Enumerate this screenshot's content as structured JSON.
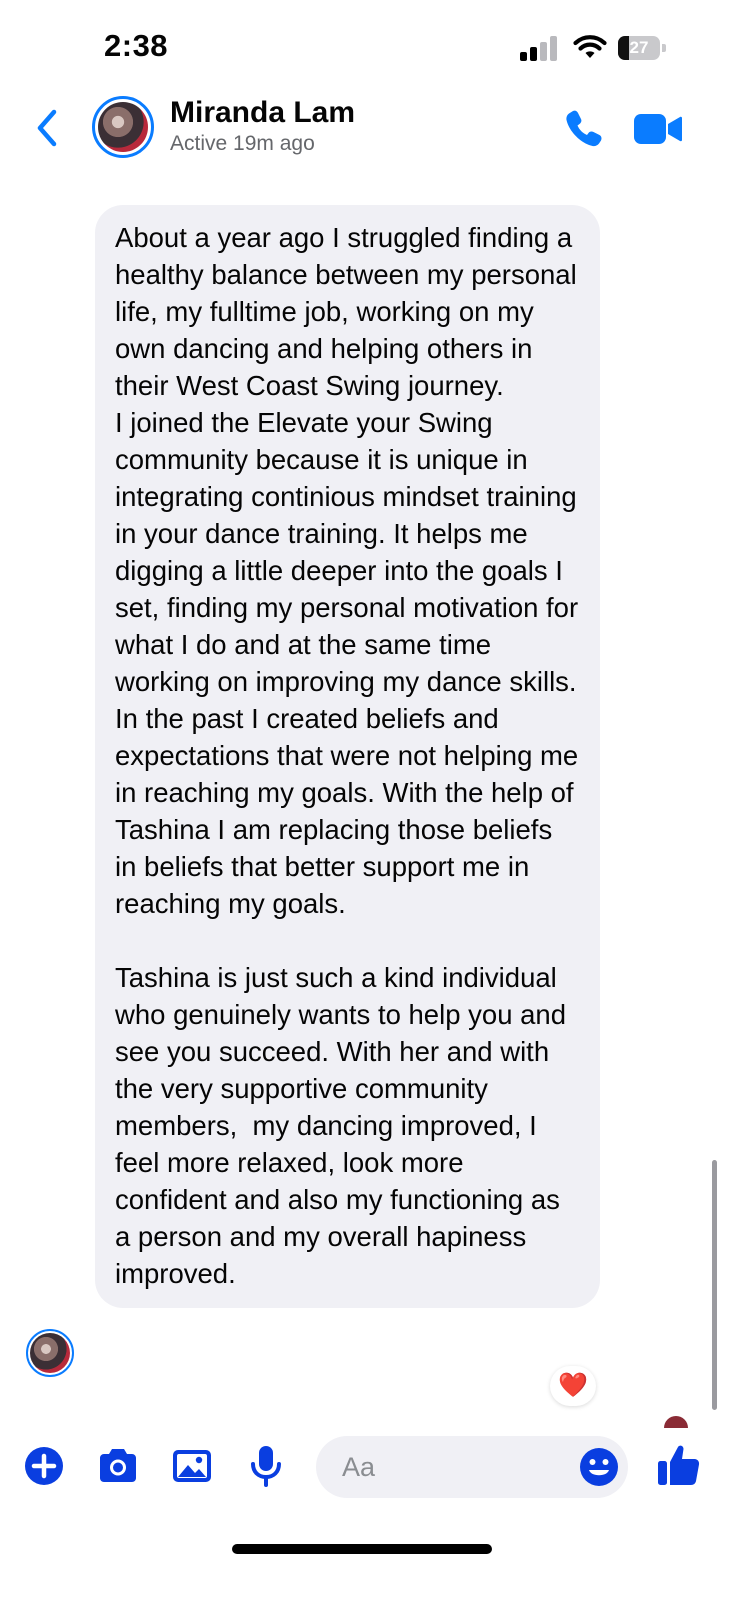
{
  "status_bar": {
    "time": "2:38",
    "battery": "27",
    "battery_level_percent": 27
  },
  "header": {
    "contact_name": "Miranda Lam",
    "status": "Active 19m ago",
    "accent_color": "#0a7cff"
  },
  "message": {
    "text": "About a year ago I struggled finding a healthy balance between my personal life, my fulltime job, working on my own dancing and helping others in their West Coast Swing journey.\nI joined the Elevate your Swing community because it is unique in integrating continious mindset training in your dance training. It helps me digging a little deeper into the goals I set, finding my personal motivation for what I do and at the same time working on improving my dance skills.\nIn the past I created beliefs and expectations that were not helping me in reaching my goals. With the help of Tashina I am replacing those beliefs in beliefs that better support me in reaching my goals.\n\nTashina is just such a kind individual who genuinely wants to help you and see you succeed. With her and with the very supportive community members,  my dancing improved, I feel more relaxed, look more confident and also my functioning as a person and my overall hapiness improved.",
    "reaction": "❤️"
  },
  "composer": {
    "placeholder": "Aa",
    "icons": [
      "plus-icon",
      "camera-icon",
      "image-icon",
      "microphone-icon",
      "emoji-icon",
      "thumbs-up-icon"
    ]
  }
}
